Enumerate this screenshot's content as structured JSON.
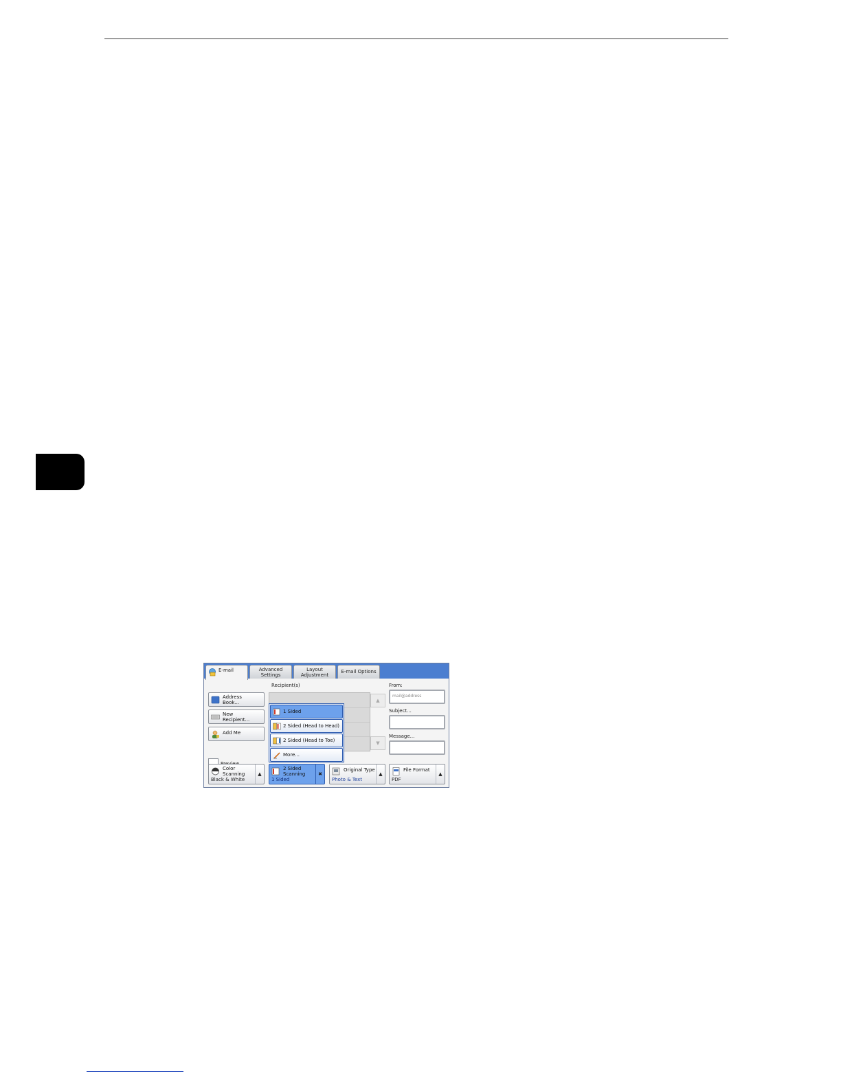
{
  "panel": {
    "tabs": [
      {
        "label": "E-mail"
      },
      {
        "label": "Advanced Settings",
        "line1": "Advanced",
        "line2": "Settings"
      },
      {
        "label": "Layout Adjustment",
        "line1": "Layout",
        "line2": "Adjustment"
      },
      {
        "label": "E-mail Options"
      }
    ],
    "left_buttons": {
      "address_book": {
        "line1": "Address",
        "line2": "Book..."
      },
      "new_recipient": {
        "line1": "New",
        "line2": "Recipient..."
      },
      "add_me": "Add Me"
    },
    "preview_label": "Preview",
    "recipients_label": "Recipient(s)",
    "dropdown_items": [
      "1 Sided",
      "2 Sided (Head to Head)",
      "2 Sided (Head to Toe)",
      "More..."
    ],
    "from_label": "From:",
    "from_value": "mail@address",
    "subject_label": "Subject...",
    "message_label": "Message...",
    "feature_buttons": {
      "color_scanning": {
        "title1": "Color",
        "title2": "Scanning",
        "value": "Black & White"
      },
      "two_sided": {
        "title1": "2 Sided",
        "title2": "Scanning",
        "value": "1 Sided"
      },
      "original_type": {
        "title": "Original Type",
        "value": "Photo & Text"
      },
      "file_format": {
        "title": "File Format",
        "value": "PDF"
      }
    },
    "colors": {
      "tab_bar": "#4b7ed0",
      "selected": "#6da1ec",
      "chapter_tab": "#000000"
    },
    "icons": {
      "arrow_up": "▲",
      "arrow_down": "▼",
      "close": "✖"
    }
  }
}
